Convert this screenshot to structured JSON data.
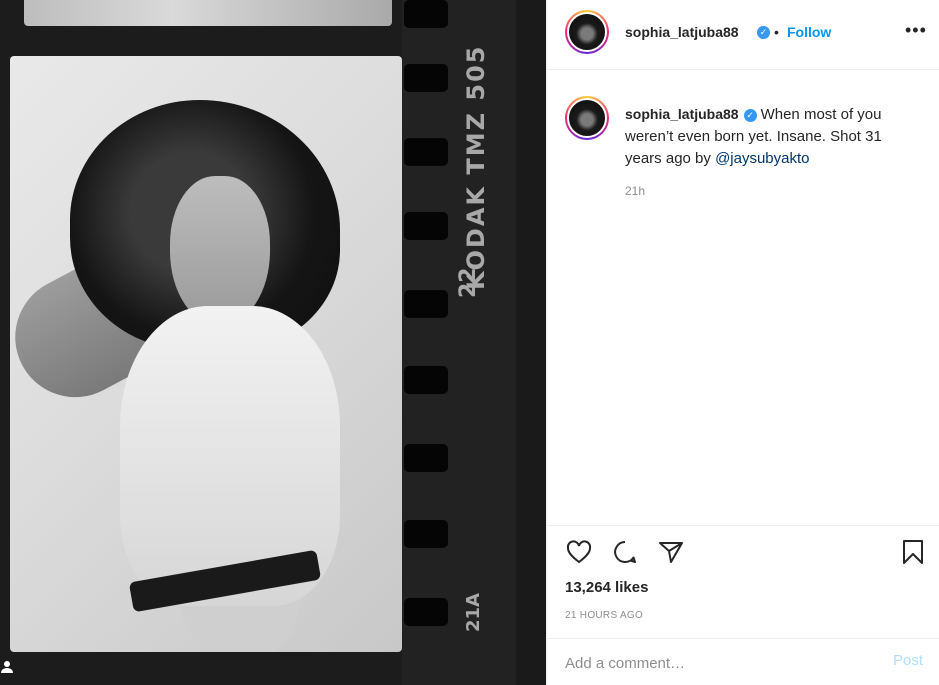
{
  "photo": {
    "film_brand": "KODAK TMZ 505",
    "film_number": "22",
    "frame_number": "21A",
    "tag_icon": "user-tag-icon"
  },
  "header": {
    "username": "sophia_latjuba88",
    "verified_icon": "verified-badge-icon",
    "separator": "•",
    "follow_label": "Follow",
    "more_icon": "more-options-icon",
    "more_glyph": "•••"
  },
  "caption": {
    "username": "sophia_latjuba88",
    "text": "When most of you weren’t even born yet. Insane. Shot 31 years ago by ",
    "mention": "@jaysubyakto",
    "time": "21h"
  },
  "actions": {
    "like_icon": "heart-icon",
    "comment_icon": "comment-icon",
    "share_icon": "share-icon",
    "save_icon": "bookmark-icon"
  },
  "likes": "13,264 likes",
  "post_time": "21 HOURS AGO",
  "comment": {
    "placeholder": "Add a comment…",
    "post_label": "Post"
  },
  "colors": {
    "accent": "#0095f6",
    "mention": "#00376b",
    "muted": "#8e8e8e",
    "post_disabled": "#b2dffc",
    "verified": "#3897f0"
  }
}
